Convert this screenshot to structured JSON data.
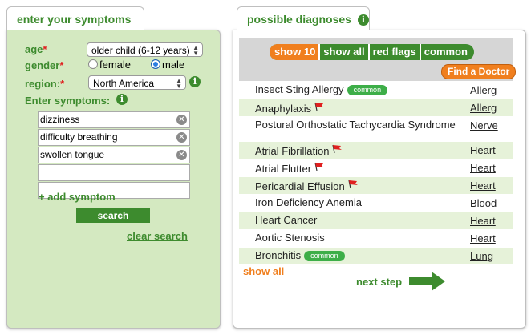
{
  "left_panel": {
    "tab_title": "enter your symptoms",
    "age_label": "age",
    "required_mark": "*",
    "age_value": "older child (6-12 years)",
    "gender_label": "gender",
    "gender_options": [
      "female",
      "male"
    ],
    "gender_selected": "male",
    "region_label": "region:",
    "region_value": "North America",
    "symptoms_label": "Enter symptoms:",
    "symptoms": [
      "dizziness",
      "difficulty breathing",
      "swollen tongue",
      "",
      ""
    ],
    "add_symptom": "+ add symptom",
    "search_button": "search",
    "clear_search": "clear search"
  },
  "right_panel": {
    "tab_title": "possible diagnoses",
    "filters": [
      {
        "label": "show 10",
        "active": true
      },
      {
        "label": "show all",
        "active": false
      },
      {
        "label": "red flags",
        "active": false
      },
      {
        "label": "common",
        "active": false
      }
    ],
    "find_doctor": "Find a Doctor",
    "diagnoses": [
      {
        "name": "Insect Sting Allergy",
        "category": "Allerg",
        "badge": "common",
        "flag": false
      },
      {
        "name": "Anaphylaxis",
        "category": "Allerg",
        "badge": "",
        "flag": true
      },
      {
        "name": "Postural Orthostatic Tachycardia Syndrome",
        "category": "Nerve",
        "badge": "",
        "flag": false
      },
      {
        "name": "Atrial Fibrillation",
        "category": "Heart",
        "badge": "",
        "flag": true
      },
      {
        "name": "Atrial Flutter",
        "category": "Heart",
        "badge": "",
        "flag": true
      },
      {
        "name": "Pericardial Effusion",
        "category": "Heart",
        "badge": "",
        "flag": true
      },
      {
        "name": "Iron Deficiency Anemia",
        "category": "Blood",
        "badge": "",
        "flag": false
      },
      {
        "name": "Heart Cancer",
        "category": "Heart",
        "badge": "",
        "flag": false
      },
      {
        "name": "Aortic Stenosis",
        "category": "Heart",
        "badge": "",
        "flag": false
      },
      {
        "name": "Bronchitis",
        "category": "Lung",
        "badge": "common",
        "flag": false
      }
    ],
    "show_all_link": "show all",
    "next_step": "next step"
  },
  "colors": {
    "brand_green": "#3d8b2e",
    "panel_green": "#d4e9c1",
    "accent_orange": "#f07f1e",
    "flag_red": "#e02020",
    "common_badge": "#3dae48"
  },
  "icons": {
    "info": "info-icon",
    "remove": "close-circle-icon",
    "flag": "red-flag-icon",
    "arrow": "right-arrow-icon",
    "select": "select-arrows-icon"
  }
}
